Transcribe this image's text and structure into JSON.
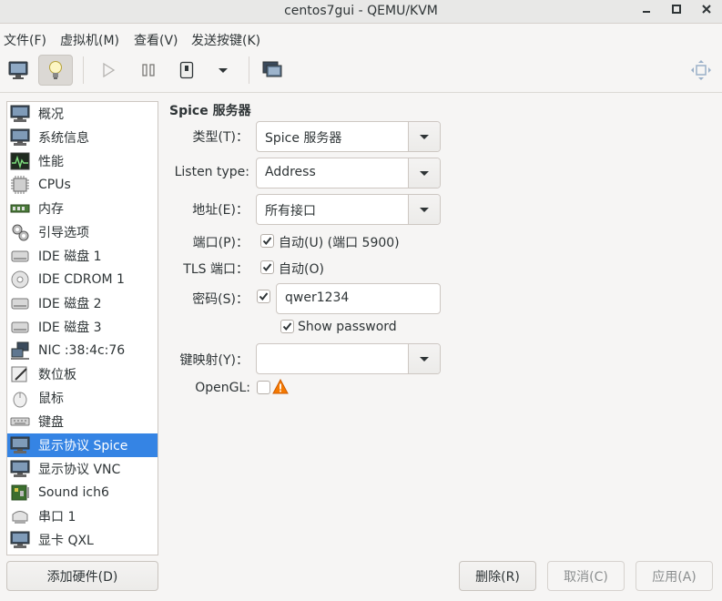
{
  "window": {
    "title": "centos7gui - QEMU/KVM"
  },
  "menubar": [
    "文件(F)",
    "虚拟机(M)",
    "查看(V)",
    "发送按键(K)"
  ],
  "toolbar": {
    "icons": [
      "monitor-icon",
      "lightbulb-icon",
      "play-icon",
      "pause-icon",
      "power-icon",
      "dropdown-icon",
      "snapshot-icon",
      "fullscreen-icon"
    ]
  },
  "hardware_list": {
    "items": [
      {
        "label": "概况",
        "icon": "monitor-icon"
      },
      {
        "label": "系统信息",
        "icon": "monitor-icon"
      },
      {
        "label": "性能",
        "icon": "performance-icon"
      },
      {
        "label": "CPUs",
        "icon": "cpu-icon"
      },
      {
        "label": "内存",
        "icon": "memory-icon"
      },
      {
        "label": "引导选项",
        "icon": "gears-icon"
      },
      {
        "label": "IDE 磁盘 1",
        "icon": "disk-icon"
      },
      {
        "label": "IDE CDROM 1",
        "icon": "cdrom-icon"
      },
      {
        "label": "IDE 磁盘 2",
        "icon": "disk-icon"
      },
      {
        "label": "IDE 磁盘 3",
        "icon": "disk-icon"
      },
      {
        "label": "NIC :38:4c:76",
        "icon": "network-icon"
      },
      {
        "label": "数位板",
        "icon": "tablet-icon"
      },
      {
        "label": "鼠标",
        "icon": "mouse-icon"
      },
      {
        "label": "键盘",
        "icon": "keyboard-icon"
      },
      {
        "label": "显示协议 Spice",
        "icon": "monitor-icon",
        "selected": true
      },
      {
        "label": "显示协议 VNC",
        "icon": "monitor-icon"
      },
      {
        "label": "Sound ich6",
        "icon": "sound-card-icon"
      },
      {
        "label": "串口 1",
        "icon": "serial-icon"
      },
      {
        "label": "显卡 QXL",
        "icon": "monitor-icon"
      }
    ],
    "add_hardware_label": "添加硬件(D)"
  },
  "details": {
    "section_title": "Spice 服务器",
    "type": {
      "label": "类型(T)：",
      "value": "Spice 服务器"
    },
    "listen_type": {
      "label": "Listen type:",
      "value": "Address"
    },
    "address": {
      "label": "地址(E)：",
      "value": "所有接口"
    },
    "port": {
      "label": "端口(P)：",
      "checkbox_label": "自动(U) (端口 5900)",
      "checked": true
    },
    "tls_port": {
      "label": "TLS 端口：",
      "checkbox_label": "自动(O)",
      "checked": true
    },
    "password": {
      "label": "密码(S)：",
      "checked": true,
      "value": "qwer1234"
    },
    "show_password": {
      "label": "Show password",
      "checked": true
    },
    "keymap": {
      "label": "键映射(Y)：",
      "value": ""
    },
    "opengl": {
      "label": "OpenGL:",
      "checked": false,
      "warning_icon": "warning-icon"
    }
  },
  "actions": {
    "remove_label": "删除(R)",
    "cancel_label": "取消(C)",
    "apply_label": "应用(A)"
  },
  "colors": {
    "selection": "#3584e4",
    "warning": "#f57900"
  }
}
